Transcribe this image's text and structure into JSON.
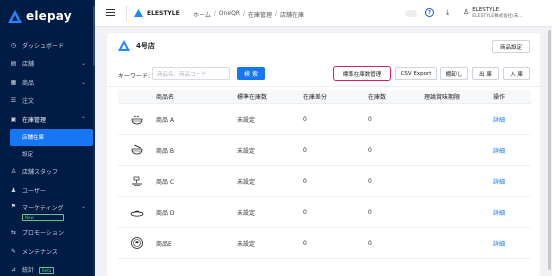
{
  "app": {
    "logo_text": "elepay",
    "brand": "ELESTYLE"
  },
  "sidebar": {
    "items": [
      {
        "label": "ダッシュボード",
        "icon": "dashboard-icon",
        "chev": ""
      },
      {
        "label": "店舗",
        "icon": "store-icon",
        "chev": "⌄"
      },
      {
        "label": "商品",
        "icon": "product-icon",
        "chev": "⌄"
      },
      {
        "label": "注文",
        "icon": "order-icon",
        "chev": ""
      },
      {
        "label": "在庫管理",
        "icon": "inventory-icon",
        "chev": "⌃"
      }
    ],
    "sub_items": [
      {
        "label": "店舗在庫"
      },
      {
        "label": "設定"
      }
    ],
    "items2": [
      {
        "label": "店舗スタッフ",
        "icon": "staff-icon",
        "chev": ""
      },
      {
        "label": "ユーザー",
        "icon": "user-icon",
        "chev": ""
      },
      {
        "label": "マーケティング",
        "icon": "marketing-icon",
        "chev": "⌄",
        "badge": "New"
      },
      {
        "label": "プロモーション",
        "icon": "promotion-icon",
        "chev": ""
      },
      {
        "label": "メンテナンス",
        "icon": "maintenance-icon",
        "chev": ""
      },
      {
        "label": "統計",
        "icon": "stats-icon",
        "chev": "",
        "badge": "Beta"
      }
    ]
  },
  "header": {
    "breadcrumb": [
      "ホーム",
      "OneQR",
      "在庫管理",
      "店舗在庫"
    ],
    "help": "?",
    "download": "⤓",
    "user_icon": "♙",
    "user_name": "ELESTYLE",
    "user_company": "ELESTYLE株式会社(未..."
  },
  "card": {
    "store_name": "4号店",
    "store_setting_button": "商品設定",
    "keyword_label": "キーワード:",
    "keyword_placeholder": "商品名、商品コード",
    "search_button": "検 索",
    "std_stock_button": "標準在庫数管理",
    "csv_button": "CSV Export",
    "inventory_button": "棚卸し",
    "out_button": "出 庫",
    "in_button": "入 庫"
  },
  "table": {
    "headers": {
      "name": "商品名",
      "std": "標準在庫数",
      "diff": "在庫差分",
      "stock": "在庫数",
      "exp": "理論賞味期限",
      "op": "操作"
    },
    "rows": [
      {
        "icon": "bowl-icon",
        "name": "商品 A",
        "std": "未設定",
        "diff": "0",
        "stock": "0",
        "exp": "",
        "op": "詳細"
      },
      {
        "icon": "noodle-icon",
        "name": "商品 B",
        "std": "未設定",
        "diff": "0",
        "stock": "0",
        "exp": "",
        "op": "詳細"
      },
      {
        "icon": "dish-icon",
        "name": "商品 C",
        "std": "未設定",
        "diff": "0",
        "stock": "0",
        "exp": "",
        "op": "詳細"
      },
      {
        "icon": "plate-icon",
        "name": "商品 D",
        "std": "未設定",
        "diff": "0",
        "stock": "0",
        "exp": "",
        "op": "詳細"
      },
      {
        "icon": "bowl2-icon",
        "name": "商品E",
        "std": "未設定",
        "diff": "0",
        "stock": "0",
        "exp": "",
        "op": "詳細"
      }
    ]
  },
  "colors": {
    "sidebar_bg": "#001b44",
    "accent": "#1676f3",
    "highlight": "#d21f78"
  }
}
